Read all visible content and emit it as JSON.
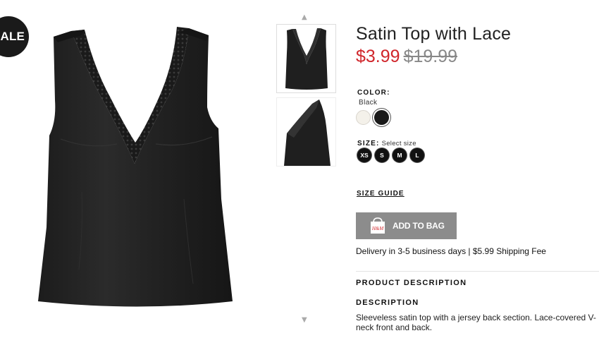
{
  "badge": {
    "label": "SALE"
  },
  "product": {
    "title": "Satin Top with Lace",
    "price_current": "$3.99",
    "price_original": "$19.99"
  },
  "color": {
    "label": "COLOR:",
    "selected": "Black",
    "swatches": [
      {
        "name": "White",
        "hex": "#f4f1ea"
      },
      {
        "name": "Black",
        "hex": "#1a1a1a"
      }
    ]
  },
  "size": {
    "label": "SIZE:",
    "hint": "Select size",
    "options": [
      "XS",
      "S",
      "M",
      "L"
    ]
  },
  "links": {
    "size_guide": "SIZE GUIDE"
  },
  "cart": {
    "add_label": "ADD TO BAG",
    "icon_text": "H&M"
  },
  "delivery": {
    "text": "Delivery in 3-5 business days | $5.99 Shipping Fee"
  },
  "details": {
    "product_description_heading": "PRODUCT DESCRIPTION",
    "description_heading": "DESCRIPTION",
    "description_text": "Sleeveless satin top with a jersey back section. Lace-covered V-neck front and back."
  },
  "gallery": {
    "up_arrow": "▲",
    "down_arrow": "▼"
  },
  "colors": {
    "sale_price": "#d0262b",
    "button_bg": "#8c8c8c"
  }
}
